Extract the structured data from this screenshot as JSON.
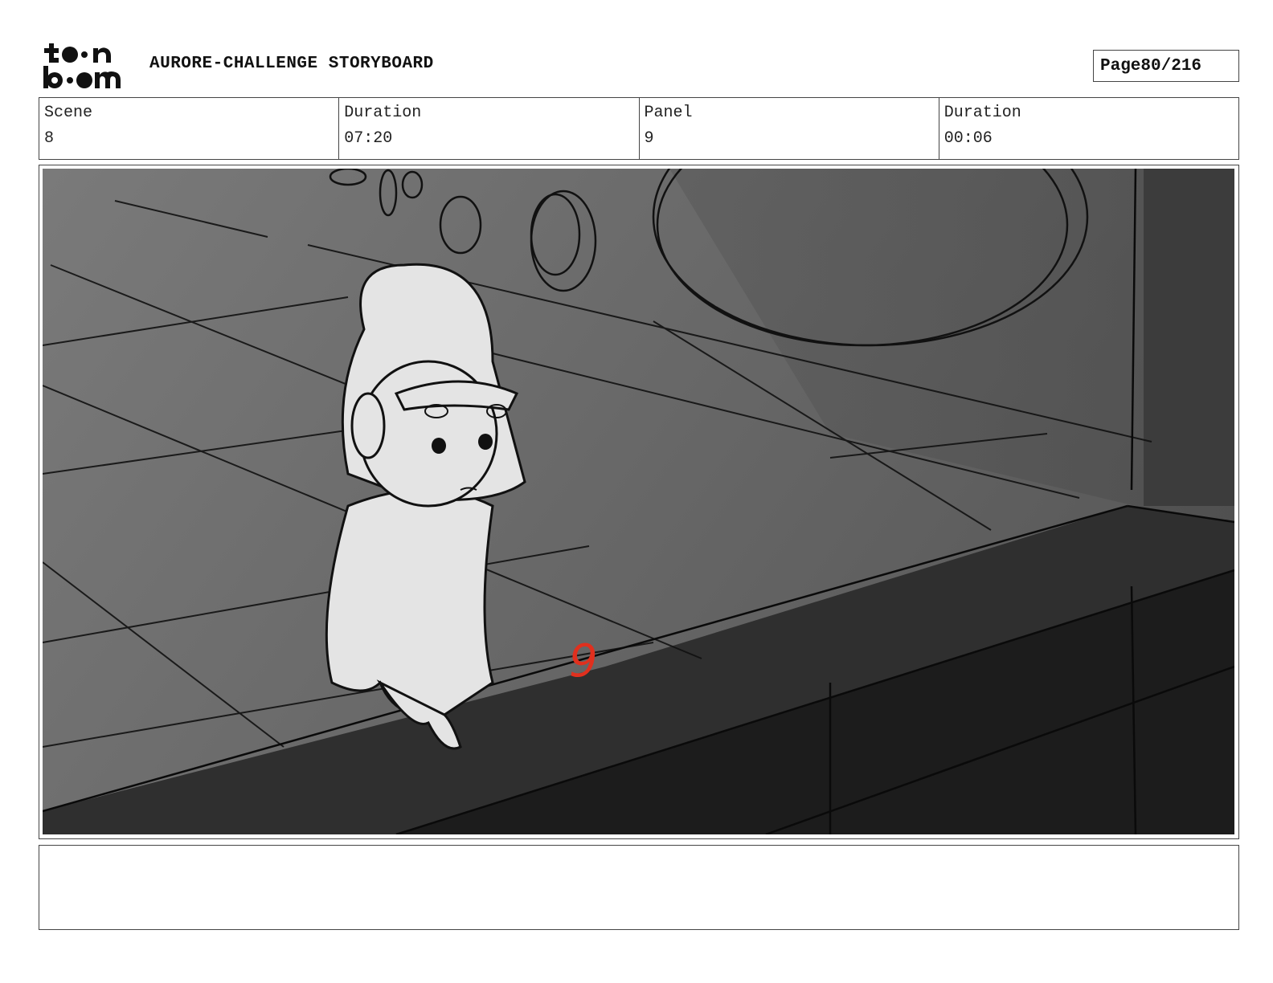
{
  "header": {
    "logo_text": "toon boom",
    "title": "AURORE-CHALLENGE STORYBOARD",
    "page_label": "Page",
    "page_value": "80/216"
  },
  "info": {
    "scene_label": "Scene",
    "scene_value": "8",
    "scene_duration_label": "Duration",
    "scene_duration_value": "07:20",
    "panel_label": "Panel",
    "panel_value": "9",
    "panel_duration_label": "Duration",
    "panel_duration_value": "00:06"
  },
  "panel": {
    "annotation": "9",
    "annotation_color": "#e0301e"
  },
  "notes": {
    "text": ""
  }
}
